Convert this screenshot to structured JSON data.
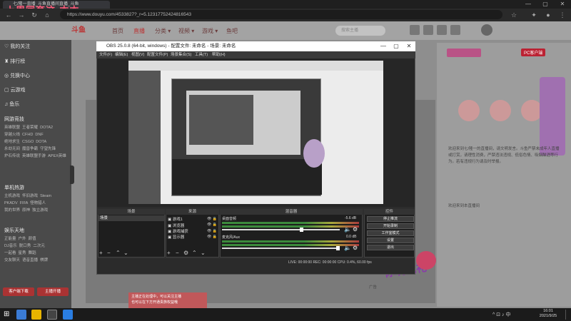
{
  "browser": {
    "overlay_title": "上周同套这·本本",
    "tab_title": "七/隆一直播_斗鱼直播间直播_斗鱼",
    "url": "https://www.douyu.com/4533827?_r=5.12317752424816543"
  },
  "site": {
    "logo": "斗鱼",
    "nav": [
      "首页",
      "直播",
      "分类 ▾",
      "视频 ▾",
      "游戏 ▾",
      "鱼吧"
    ],
    "search_placeholder": "搜索主播",
    "pc_client_button": "PC客户端"
  },
  "sidebar": {
    "menu": [
      "我的关注",
      "排行榜",
      "兑换中心",
      "云游戏",
      "鱼乐"
    ],
    "sections": [
      {
        "title": "网游竞技",
        "items": "英雄联盟  王者荣耀  DOTA2\n穿越火线  CFHD  DNF\n绝地求生  CSGO  DOTA\n永劫无间  魔兽争霸  守望先锋\n炉石传说  英雄联盟手游  APEX英雄"
      },
      {
        "title": "单机热游",
        "items": "主机游戏  怀旧游戏  Steam\nPKADV  FIFA  怪物猎人\n我的世界  原神  独立游戏"
      },
      {
        "title": "娱乐天地",
        "items": "正能量  户外  颜值\nDJ音乐  脱口秀  二次元\n一起看  星秀  舞蹈\n交友聊天  语音直播  棋牌"
      }
    ],
    "btn_left": "客户端下载",
    "btn_right": "主播开播"
  },
  "chat": {
    "text": "欢迎来到七/隆一的直播间，请文明发言。斗鱼严禁未成年人直播或打赏，请理性消费，严禁违法违规、低俗色情、吸烟酗酒等行为。若有违规行为请及时举报。",
    "user_line": "欢迎来到本直播间",
    "ad_label": "广告",
    "promo": "主播正在处理中，可以关注主播\n也可以在下方开通贵族权益哦"
  },
  "gift": {
    "label": "你玩我礼"
  },
  "obs": {
    "title": "OBS 25.0.8 (64-bit, windows) - 配置文件: 未命名 - 场景: 未命名",
    "menu": [
      "文件(F)",
      "编辑(E)",
      "视图(V)",
      "配置文件(P)",
      "场景集合(S)",
      "工具(T)",
      "帮助(H)"
    ],
    "dock_titles": [
      "场景",
      "来源",
      "混音器",
      "控件"
    ],
    "scene": "场景",
    "sources": [
      "游戏1",
      "浏览器",
      "游戏捕获",
      "显示器"
    ],
    "mixer": [
      {
        "name": "桌面音频",
        "db": "-5.6 dB"
      },
      {
        "name": "麦克风/Aux",
        "db": "0.0 dB"
      }
    ],
    "controls": [
      "停止推流",
      "开始录制",
      "工作室模式",
      "设置",
      "退出"
    ],
    "status": "LIVE: 00:00:00   REC: 00:00:00   CPU: 0.4%, 60.00 fps"
  },
  "taskbar": {
    "time": "16:01",
    "date": "2021/9/25"
  }
}
